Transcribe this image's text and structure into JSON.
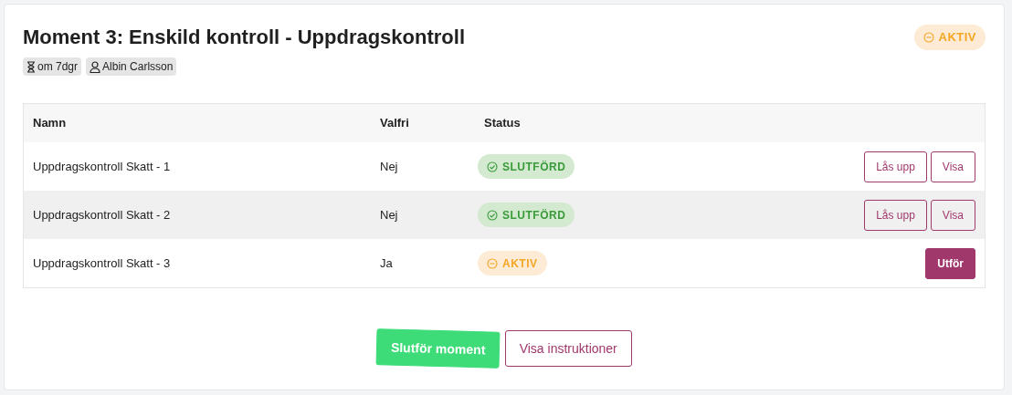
{
  "title": "Moment 3: Enskild kontroll - Uppdragskontroll",
  "status": {
    "kind": "active",
    "label": "AKTIV"
  },
  "chips": [
    {
      "kind": "time",
      "label": "om 7dgr"
    },
    {
      "kind": "person",
      "label": "Albin Carlsson"
    }
  ],
  "table": {
    "columns": [
      "Namn",
      "Valfri",
      "Status"
    ],
    "rows": [
      {
        "name": "Uppdragskontroll Skatt - 1",
        "optional": "Nej",
        "status": {
          "kind": "done",
          "label": "SLUTFÖRD"
        },
        "actions": [
          {
            "kind": "outline",
            "label": "Lås upp"
          },
          {
            "kind": "outline",
            "label": "Visa"
          }
        ]
      },
      {
        "name": "Uppdragskontroll Skatt - 2",
        "optional": "Nej",
        "status": {
          "kind": "done",
          "label": "SLUTFÖRD"
        },
        "actions": [
          {
            "kind": "outline",
            "label": "Lås upp"
          },
          {
            "kind": "outline",
            "label": "Visa"
          }
        ]
      },
      {
        "name": "Uppdragskontroll Skatt - 3",
        "optional": "Ja",
        "status": {
          "kind": "active",
          "label": "AKTIV"
        },
        "actions": [
          {
            "kind": "filled",
            "label": "Utför"
          }
        ]
      }
    ]
  },
  "footer_buttons": [
    {
      "kind": "primary",
      "label": "Slutför moment"
    },
    {
      "kind": "outline",
      "label": "Visa instruktioner"
    }
  ]
}
